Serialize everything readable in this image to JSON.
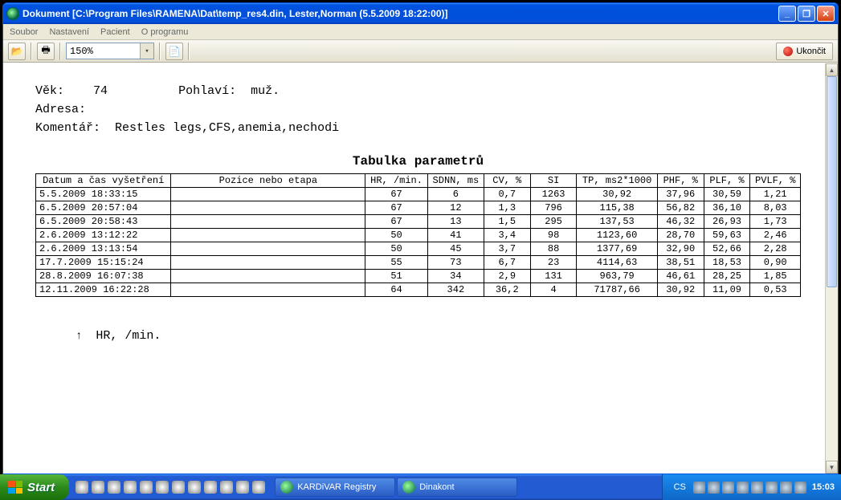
{
  "title": "Dokument [C:\\Program Files\\RAMENA\\Dat\\temp_res4.din, Lester,Norman  (5.5.2009 18:22:00)]",
  "menu": {
    "soubor": "Soubor",
    "nastaveni": "Nastavení",
    "pacient": "Pacient",
    "oprogramu": "O programu"
  },
  "toolbar": {
    "zoom": "150%",
    "end": "Ukončit"
  },
  "patient": {
    "age_label": "Věk:",
    "age": "74",
    "sex_label": "Pohlaví:",
    "sex": "muž.",
    "addr_label": "Adresa:",
    "comment_label": "Komentář:",
    "comment": "Restles legs,CFS,anemia,nechodi"
  },
  "table": {
    "title": "Tabulka parametrů",
    "headers": {
      "datetime": "Datum a čas vyšetření",
      "pos": "Pozice nebo etapa",
      "hr": "HR, /min.",
      "sdnn": "SDNN, ms",
      "cv": "CV, %",
      "si": "SI",
      "tp": "TP, ms2*1000",
      "phf": "PHF, %",
      "plf": "PLF, %",
      "pvlf": "PVLF, %"
    },
    "rows": [
      {
        "dt": "5.5.2009 18:33:15",
        "pos": "",
        "hr": "67",
        "sdnn": "6",
        "cv": "0,7",
        "si": "1263",
        "tp": "30,92",
        "phf": "37,96",
        "plf": "30,59",
        "pvlf": "1,21"
      },
      {
        "dt": "6.5.2009 20:57:04",
        "pos": "",
        "hr": "67",
        "sdnn": "12",
        "cv": "1,3",
        "si": "796",
        "tp": "115,38",
        "phf": "56,82",
        "plf": "36,10",
        "pvlf": "8,03"
      },
      {
        "dt": "6.5.2009 20:58:43",
        "pos": "",
        "hr": "67",
        "sdnn": "13",
        "cv": "1,5",
        "si": "295",
        "tp": "137,53",
        "phf": "46,32",
        "plf": "26,93",
        "pvlf": "1,73"
      },
      {
        "dt": "2.6.2009 13:12:22",
        "pos": "",
        "hr": "50",
        "sdnn": "41",
        "cv": "3,4",
        "si": "98",
        "tp": "1123,60",
        "phf": "28,70",
        "plf": "59,63",
        "pvlf": "2,46"
      },
      {
        "dt": "2.6.2009 13:13:54",
        "pos": "",
        "hr": "50",
        "sdnn": "45",
        "cv": "3,7",
        "si": "88",
        "tp": "1377,69",
        "phf": "32,90",
        "plf": "52,66",
        "pvlf": "2,28"
      },
      {
        "dt": "17.7.2009 15:15:24",
        "pos": "",
        "hr": "55",
        "sdnn": "73",
        "cv": "6,7",
        "si": "23",
        "tp": "4114,63",
        "phf": "38,51",
        "plf": "18,53",
        "pvlf": "0,90"
      },
      {
        "dt": "28.8.2009 16:07:38",
        "pos": "",
        "hr": "51",
        "sdnn": "34",
        "cv": "2,9",
        "si": "131",
        "tp": "963,79",
        "phf": "46,61",
        "plf": "28,25",
        "pvlf": "1,85"
      },
      {
        "dt": "12.11.2009 16:22:28",
        "pos": "",
        "hr": "64",
        "sdnn": "342",
        "cv": "36,2",
        "si": "4",
        "tp": "71787,66",
        "phf": "30,92",
        "plf": "11,09",
        "pvlf": "0,53"
      }
    ]
  },
  "axis_label": "HR, /min.",
  "taskbar": {
    "start": "Start",
    "tasks": [
      {
        "label": "KARDiVAR Registry"
      },
      {
        "label": "Dinakont"
      }
    ],
    "lang": "CS",
    "clock": "15:03"
  }
}
